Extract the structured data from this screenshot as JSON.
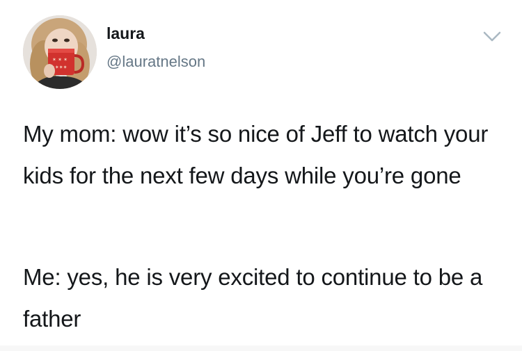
{
  "tweet": {
    "author": {
      "display_name": "laura",
      "handle": "@lauratnelson",
      "avatar_icon": "profile-photo"
    },
    "menu_icon": "chevron-down-icon",
    "paragraphs": [
      "My mom: wow it’s so nice of Jeff to watch your kids for the next few days while you’re gone",
      "Me: yes, he is very excited to continue to be a father"
    ]
  },
  "colors": {
    "text": "#14171a",
    "secondary": "#657786",
    "caret": "#aab8c2",
    "background": "#ffffff"
  }
}
